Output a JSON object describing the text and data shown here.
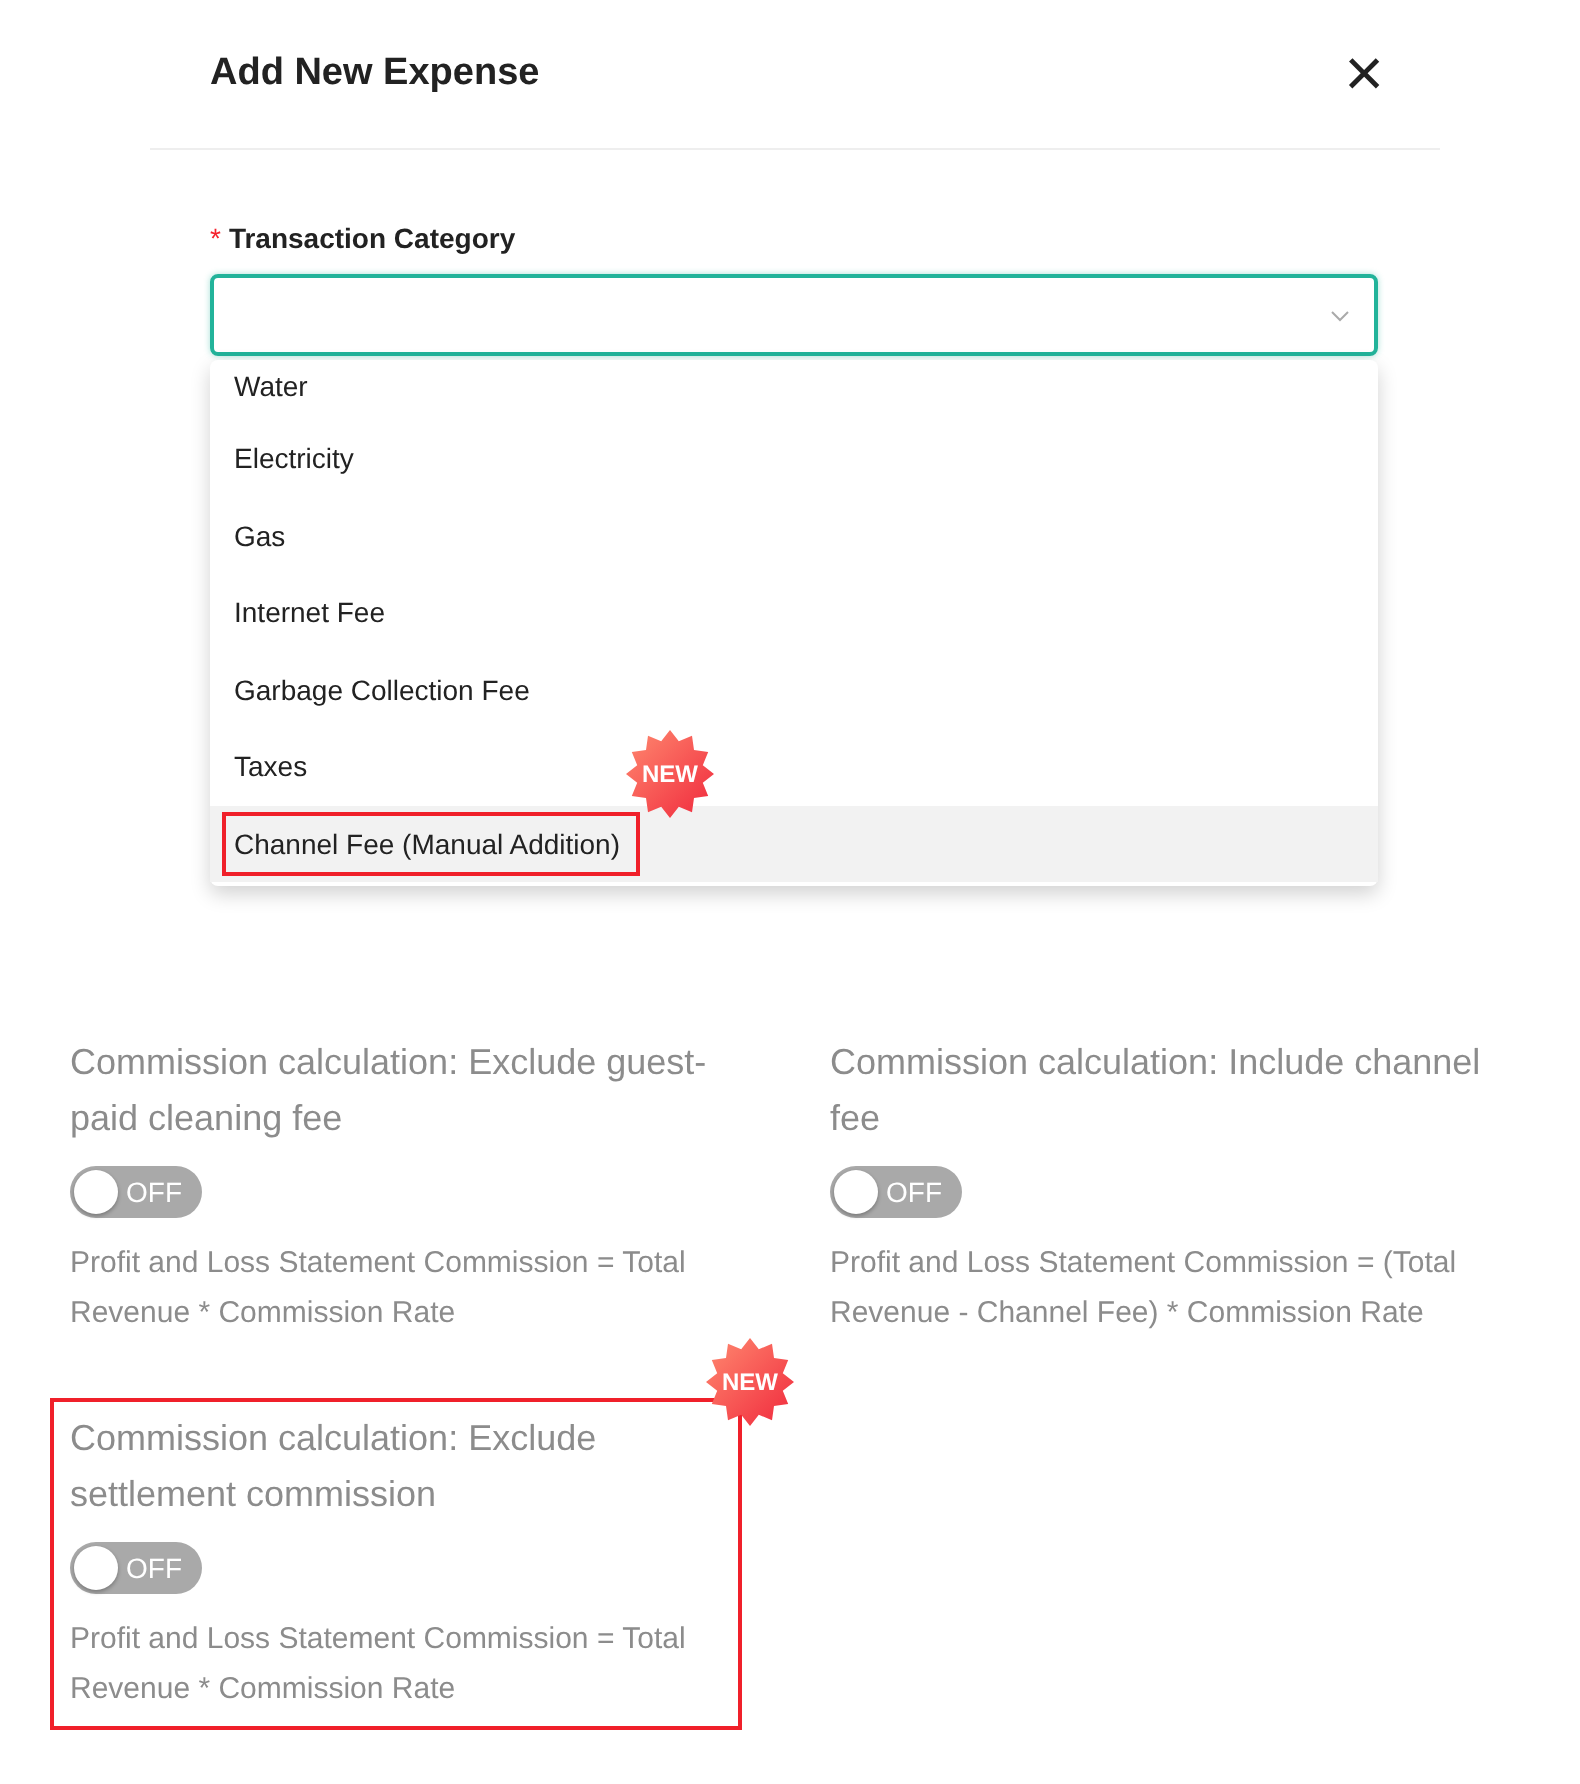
{
  "dialog": {
    "title": "Add New Expense",
    "close": "×"
  },
  "field": {
    "label": "Transaction Category",
    "required_mark": "*"
  },
  "dropdown": [
    {
      "label": "Water",
      "selected": false,
      "highlighted": false
    },
    {
      "label": "Electricity",
      "selected": false,
      "highlighted": false
    },
    {
      "label": "Gas",
      "selected": false,
      "highlighted": false
    },
    {
      "label": "Internet Fee",
      "selected": false,
      "highlighted": false
    },
    {
      "label": "Garbage Collection Fee",
      "selected": false,
      "highlighted": false
    },
    {
      "label": "Taxes",
      "selected": false,
      "highlighted": false
    },
    {
      "label": "Channel Fee (Manual Addition)",
      "selected": true,
      "highlighted": true,
      "badge": "NEW"
    }
  ],
  "settings": [
    {
      "title": "Commission calculation: Exclude guest-paid cleaning fee",
      "on": false,
      "toggle_text": "OFF",
      "formula": "Profit and Loss Statement Commission = Total Revenue * Commission Rate",
      "highlighted": false
    },
    {
      "title": "Commission calculation: Include channel fee",
      "on": false,
      "toggle_text": "OFF",
      "formula": "Profit and Loss Statement Commission = (Total Revenue - Channel Fee) * Commission Rate",
      "highlighted": false
    },
    {
      "title": "Commission calculation: Exclude settlement commission",
      "on": false,
      "toggle_text": "OFF",
      "formula": "Profit and Loss Statement Commission = Total Revenue * Commission Rate",
      "highlighted": true,
      "badge": "NEW"
    }
  ]
}
